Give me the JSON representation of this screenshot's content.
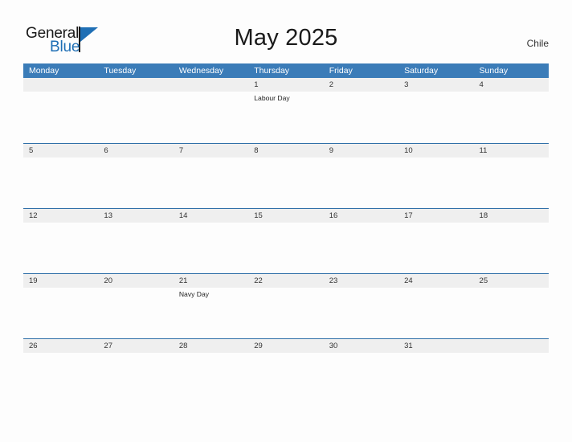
{
  "brand": {
    "name_part1": "General",
    "name_part2": "Blue",
    "flag_icon": "flag-triangle-icon"
  },
  "header": {
    "title": "May 2025",
    "country": "Chile"
  },
  "calendar": {
    "weekdays": [
      "Monday",
      "Tuesday",
      "Wednesday",
      "Thursday",
      "Friday",
      "Saturday",
      "Sunday"
    ],
    "weeks": [
      {
        "days": [
          {
            "num": "",
            "event": ""
          },
          {
            "num": "",
            "event": ""
          },
          {
            "num": "",
            "event": ""
          },
          {
            "num": "1",
            "event": "Labour Day"
          },
          {
            "num": "2",
            "event": ""
          },
          {
            "num": "3",
            "event": ""
          },
          {
            "num": "4",
            "event": ""
          }
        ]
      },
      {
        "days": [
          {
            "num": "5",
            "event": ""
          },
          {
            "num": "6",
            "event": ""
          },
          {
            "num": "7",
            "event": ""
          },
          {
            "num": "8",
            "event": ""
          },
          {
            "num": "9",
            "event": ""
          },
          {
            "num": "10",
            "event": ""
          },
          {
            "num": "11",
            "event": ""
          }
        ]
      },
      {
        "days": [
          {
            "num": "12",
            "event": ""
          },
          {
            "num": "13",
            "event": ""
          },
          {
            "num": "14",
            "event": ""
          },
          {
            "num": "15",
            "event": ""
          },
          {
            "num": "16",
            "event": ""
          },
          {
            "num": "17",
            "event": ""
          },
          {
            "num": "18",
            "event": ""
          }
        ]
      },
      {
        "days": [
          {
            "num": "19",
            "event": ""
          },
          {
            "num": "20",
            "event": ""
          },
          {
            "num": "21",
            "event": "Navy Day"
          },
          {
            "num": "22",
            "event": ""
          },
          {
            "num": "23",
            "event": ""
          },
          {
            "num": "24",
            "event": ""
          },
          {
            "num": "25",
            "event": ""
          }
        ]
      },
      {
        "days": [
          {
            "num": "26",
            "event": ""
          },
          {
            "num": "27",
            "event": ""
          },
          {
            "num": "28",
            "event": ""
          },
          {
            "num": "29",
            "event": ""
          },
          {
            "num": "30",
            "event": ""
          },
          {
            "num": "31",
            "event": ""
          },
          {
            "num": "",
            "event": ""
          }
        ]
      }
    ]
  },
  "colors": {
    "header_blue": "#3b7cb8",
    "brand_blue": "#1f6fb5",
    "row_band": "#efefef",
    "row_divider": "#2f6fa8",
    "page_background": "#fdfdfd"
  }
}
